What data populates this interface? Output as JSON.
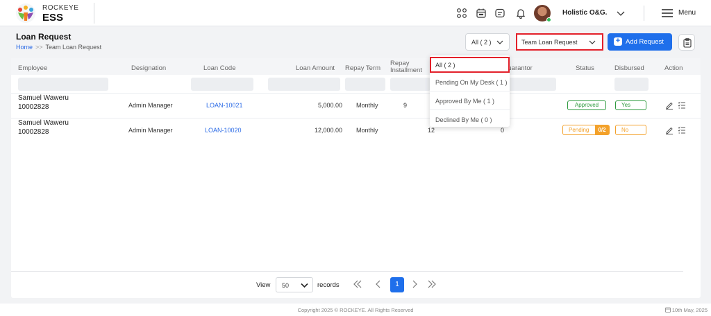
{
  "brand": {
    "top": "ROCKEYE",
    "main": "ESS"
  },
  "header": {
    "org_name": "Holistic O&G.",
    "menu_label": "Menu"
  },
  "page": {
    "title": "Loan Request",
    "breadcrumb": {
      "home": "Home",
      "sep": ">>",
      "current": "Team Loan Request"
    }
  },
  "toolbar": {
    "filter_all": "All ( 2 )",
    "team_filter": "Team Loan Request",
    "add_request": "Add Request"
  },
  "table": {
    "columns": {
      "employee": "Employee",
      "designation": "Designation",
      "loan_code": "Loan Code",
      "loan_amount": "Loan Amount",
      "repay_term": "Repay Term",
      "repay_installment_1": "Repay",
      "repay_installment_2": "Installment",
      "guarantor": "Guarantor",
      "status": "Status",
      "disbursed": "Disbursed",
      "action": "Action"
    },
    "rows": [
      {
        "name": "Samuel Waweru",
        "id": "10002828",
        "designation": "Admin Manager",
        "loan_code": "LOAN-10021",
        "amount": "5,000.00",
        "term": "Monthly",
        "installment": "9",
        "guarantor": "",
        "status": "Approved",
        "disbursed": "Yes"
      },
      {
        "name": "Samuel Waweru",
        "id": "10002828",
        "designation": "Admin Manager",
        "loan_code": "LOAN-10020",
        "amount": "12,000.00",
        "term": "Monthly",
        "installment": "12",
        "guarantor": "0",
        "status": "Pending",
        "status_count": "0/2",
        "disbursed": "No"
      }
    ]
  },
  "dropdown": {
    "items": [
      "All ( 2 )",
      "Pending On My Desk ( 1 )",
      "Approved By Me ( 1 )",
      "Declined By Me ( 0 )"
    ]
  },
  "pagination": {
    "view": "View",
    "page_size": "50",
    "records": "records",
    "current_page": "1"
  },
  "footer": {
    "copyright": "Copyright 2025 © ROCKEYE. All Rights Reserved",
    "date": "10th May, 2025"
  },
  "colors": {
    "primary": "#1f6feb",
    "highlight": "#e3202a",
    "approved": "#2e9a3e",
    "pending": "#f3a12a"
  }
}
